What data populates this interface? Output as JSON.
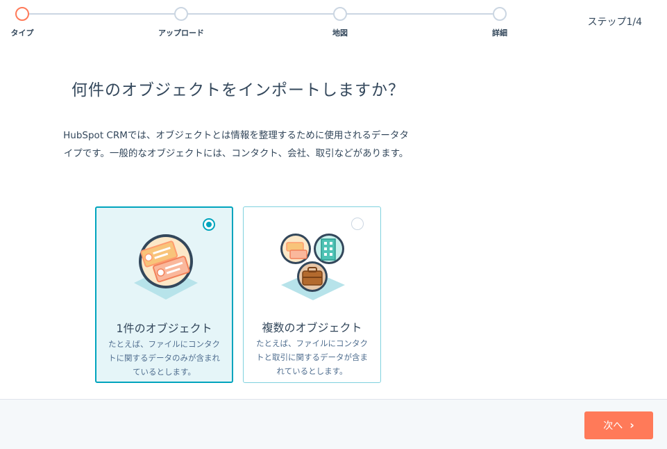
{
  "stepper": {
    "steps": [
      {
        "label": "タイプ",
        "active": true
      },
      {
        "label": "アップロード",
        "active": false
      },
      {
        "label": "地図",
        "active": false
      },
      {
        "label": "詳細",
        "active": false
      }
    ],
    "count": "ステップ1/4"
  },
  "main": {
    "title": "何件のオブジェクトをインポートしますか？",
    "description": "HubSpot CRMでは、オブジェクトとは情報を整理するために使用されるデータタイプです。一般的なオブジェクトには、コンタクト、会社、取引などがあります。"
  },
  "options": [
    {
      "title": "1件のオブジェクト",
      "description": "たとえば、ファイルにコンタクトに関するデータのみが含まれているとします。",
      "selected": true,
      "icon": "contacts-illustration-icon"
    },
    {
      "title": "複数のオブジェクト",
      "description": "たとえば、ファイルにコンタクトと取引に関するデータが含まれているとします。",
      "selected": false,
      "icon": "multiple-objects-illustration-icon"
    }
  ],
  "footer": {
    "next_label": "次へ",
    "next_icon": "chevron-right-icon"
  },
  "colors": {
    "accent": "#ff7a59",
    "selected": "#00a4bd",
    "text": "#33475b"
  }
}
